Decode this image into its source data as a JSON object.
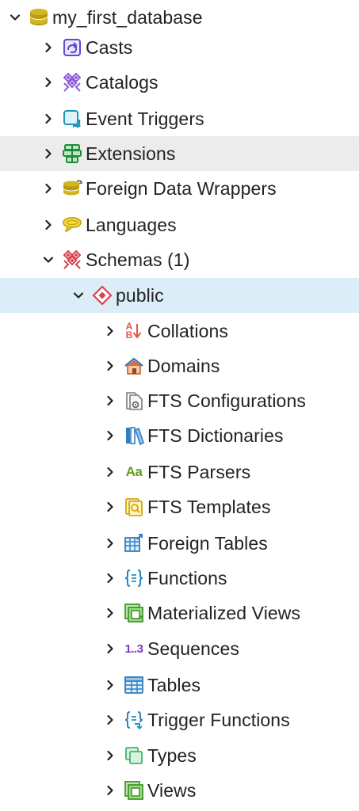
{
  "tree": {
    "root": {
      "label": "my_first_database",
      "icon": "database-icon",
      "expanded": true
    },
    "database_children": [
      {
        "label": "Casts",
        "icon": "casts-icon"
      },
      {
        "label": "Catalogs",
        "icon": "catalogs-icon"
      },
      {
        "label": "Event Triggers",
        "icon": "event-triggers-icon"
      },
      {
        "label": "Extensions",
        "icon": "extensions-icon",
        "hovered": true
      },
      {
        "label": "Foreign Data Wrappers",
        "icon": "foreign-data-wrappers-icon"
      },
      {
        "label": "Languages",
        "icon": "languages-icon"
      },
      {
        "label": "Schemas (1)",
        "icon": "schemas-icon",
        "expanded": true
      }
    ],
    "schema": {
      "label": "public",
      "icon": "schema-icon",
      "expanded": true,
      "selected": true
    },
    "schema_children": [
      {
        "label": "Collations",
        "icon": "collations-icon"
      },
      {
        "label": "Domains",
        "icon": "domains-icon"
      },
      {
        "label": "FTS Configurations",
        "icon": "fts-configurations-icon"
      },
      {
        "label": "FTS Dictionaries",
        "icon": "fts-dictionaries-icon"
      },
      {
        "label": "FTS Parsers",
        "icon": "fts-parsers-icon"
      },
      {
        "label": "FTS Templates",
        "icon": "fts-templates-icon"
      },
      {
        "label": "Foreign Tables",
        "icon": "foreign-tables-icon"
      },
      {
        "label": "Functions",
        "icon": "functions-icon"
      },
      {
        "label": "Materialized Views",
        "icon": "materialized-views-icon"
      },
      {
        "label": "Sequences",
        "icon": "sequences-icon"
      },
      {
        "label": "Tables",
        "icon": "tables-icon"
      },
      {
        "label": "Trigger Functions",
        "icon": "trigger-functions-icon"
      },
      {
        "label": "Types",
        "icon": "types-icon"
      },
      {
        "label": "Views",
        "icon": "views-icon"
      }
    ],
    "glyphs": {
      "fts_parsers": "Aa",
      "sequences": "1..3",
      "collations_a": "A",
      "collations_b": "B"
    },
    "colors": {
      "hover_row": "#ececec",
      "selected_row": "#dbeef8",
      "text": "#222222"
    }
  }
}
